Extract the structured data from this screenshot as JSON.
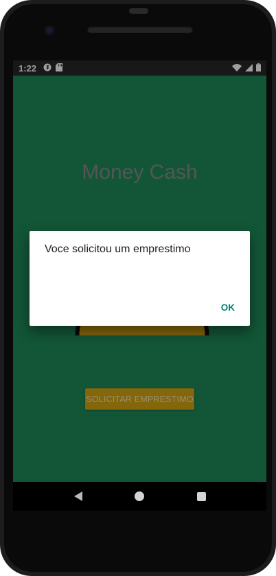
{
  "status_bar": {
    "time": "1:22",
    "left_icons": [
      "notification-icon",
      "sd-card-icon"
    ],
    "right_icons": [
      "wifi-icon",
      "signal-icon",
      "battery-icon"
    ]
  },
  "app": {
    "title": "Money Cash",
    "primary_button_label": "SOLICITAR EMPRESTIMO",
    "colors": {
      "background": "#1e8c5a",
      "button": "#d6a513",
      "title": "#8a8a8a"
    }
  },
  "dialog": {
    "message": "Voce solicitou um emprestimo",
    "ok_label": "OK",
    "accent_color": "#008577"
  },
  "nav_bar": {
    "buttons": [
      "back-icon",
      "home-icon",
      "recents-icon"
    ]
  }
}
